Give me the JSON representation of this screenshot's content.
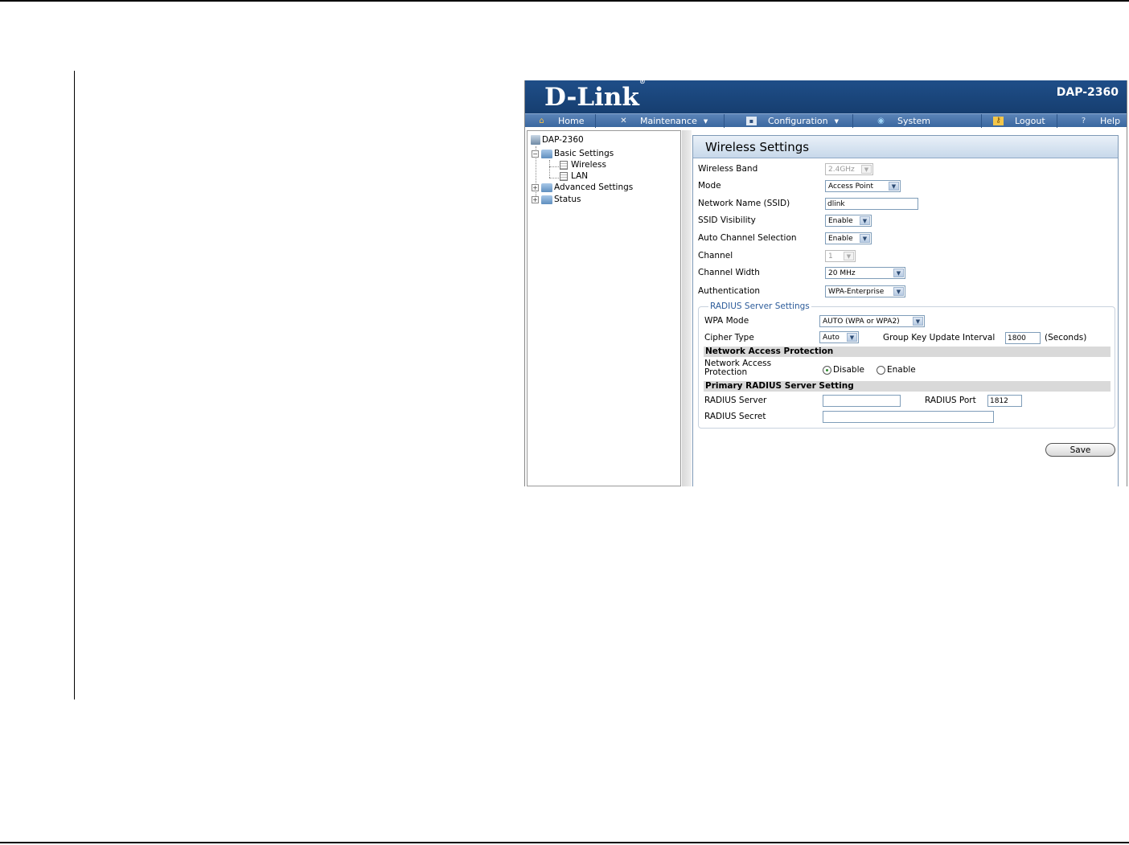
{
  "header": {
    "logo": "D-Link",
    "model": "DAP-2360"
  },
  "nav": [
    {
      "label": "Home",
      "icon": "home-icon",
      "has_menu": false
    },
    {
      "label": "Maintenance",
      "icon": "tools-icon",
      "has_menu": true
    },
    {
      "label": "Configuration",
      "icon": "floppy-icon",
      "has_menu": true
    },
    {
      "label": "System",
      "icon": "globe-icon",
      "has_menu": false
    },
    {
      "label": "Logout",
      "icon": "key-icon",
      "has_menu": false
    },
    {
      "label": "Help",
      "icon": "help-icon",
      "has_menu": false
    }
  ],
  "tree": {
    "root": "DAP-2360",
    "basic": "Basic Settings",
    "wireless": "Wireless",
    "lan": "LAN",
    "advanced": "Advanced Settings",
    "status": "Status"
  },
  "panel": {
    "title": "Wireless Settings",
    "labels": {
      "band": "Wireless Band",
      "mode": "Mode",
      "ssid": "Network Name (SSID)",
      "ssid_visibility": "SSID Visibility",
      "auto_channel": "Auto Channel Selection",
      "channel": "Channel",
      "channel_width": "Channel Width",
      "auth": "Authentication"
    },
    "values": {
      "band": "2.4GHz",
      "mode": "Access Point",
      "ssid": "dlink",
      "ssid_visibility": "Enable",
      "auto_channel": "Enable",
      "channel": "1",
      "channel_width": "20 MHz",
      "auth": "WPA-Enterprise"
    }
  },
  "radius": {
    "legend": "RADIUS Server Settings",
    "wpa_mode_label": "WPA Mode",
    "wpa_mode_value": "AUTO (WPA or WPA2)",
    "cipher_label": "Cipher Type",
    "cipher_value": "Auto",
    "gk_label": "Group Key Update Interval",
    "gk_value": "1800",
    "gk_unit": "(Seconds)",
    "nap_header": "Network Access Protection",
    "nap_label_1": "Network Access",
    "nap_label_2": "Protection",
    "nap_disable": "Disable",
    "nap_enable": "Enable",
    "nap_selected": "Disable",
    "primary_header": "Primary RADIUS Server Setting",
    "server_label": "RADIUS Server",
    "server_value": "",
    "port_label": "RADIUS Port",
    "port_value": "1812",
    "secret_label": "RADIUS Secret",
    "secret_value": ""
  },
  "save_label": "Save"
}
